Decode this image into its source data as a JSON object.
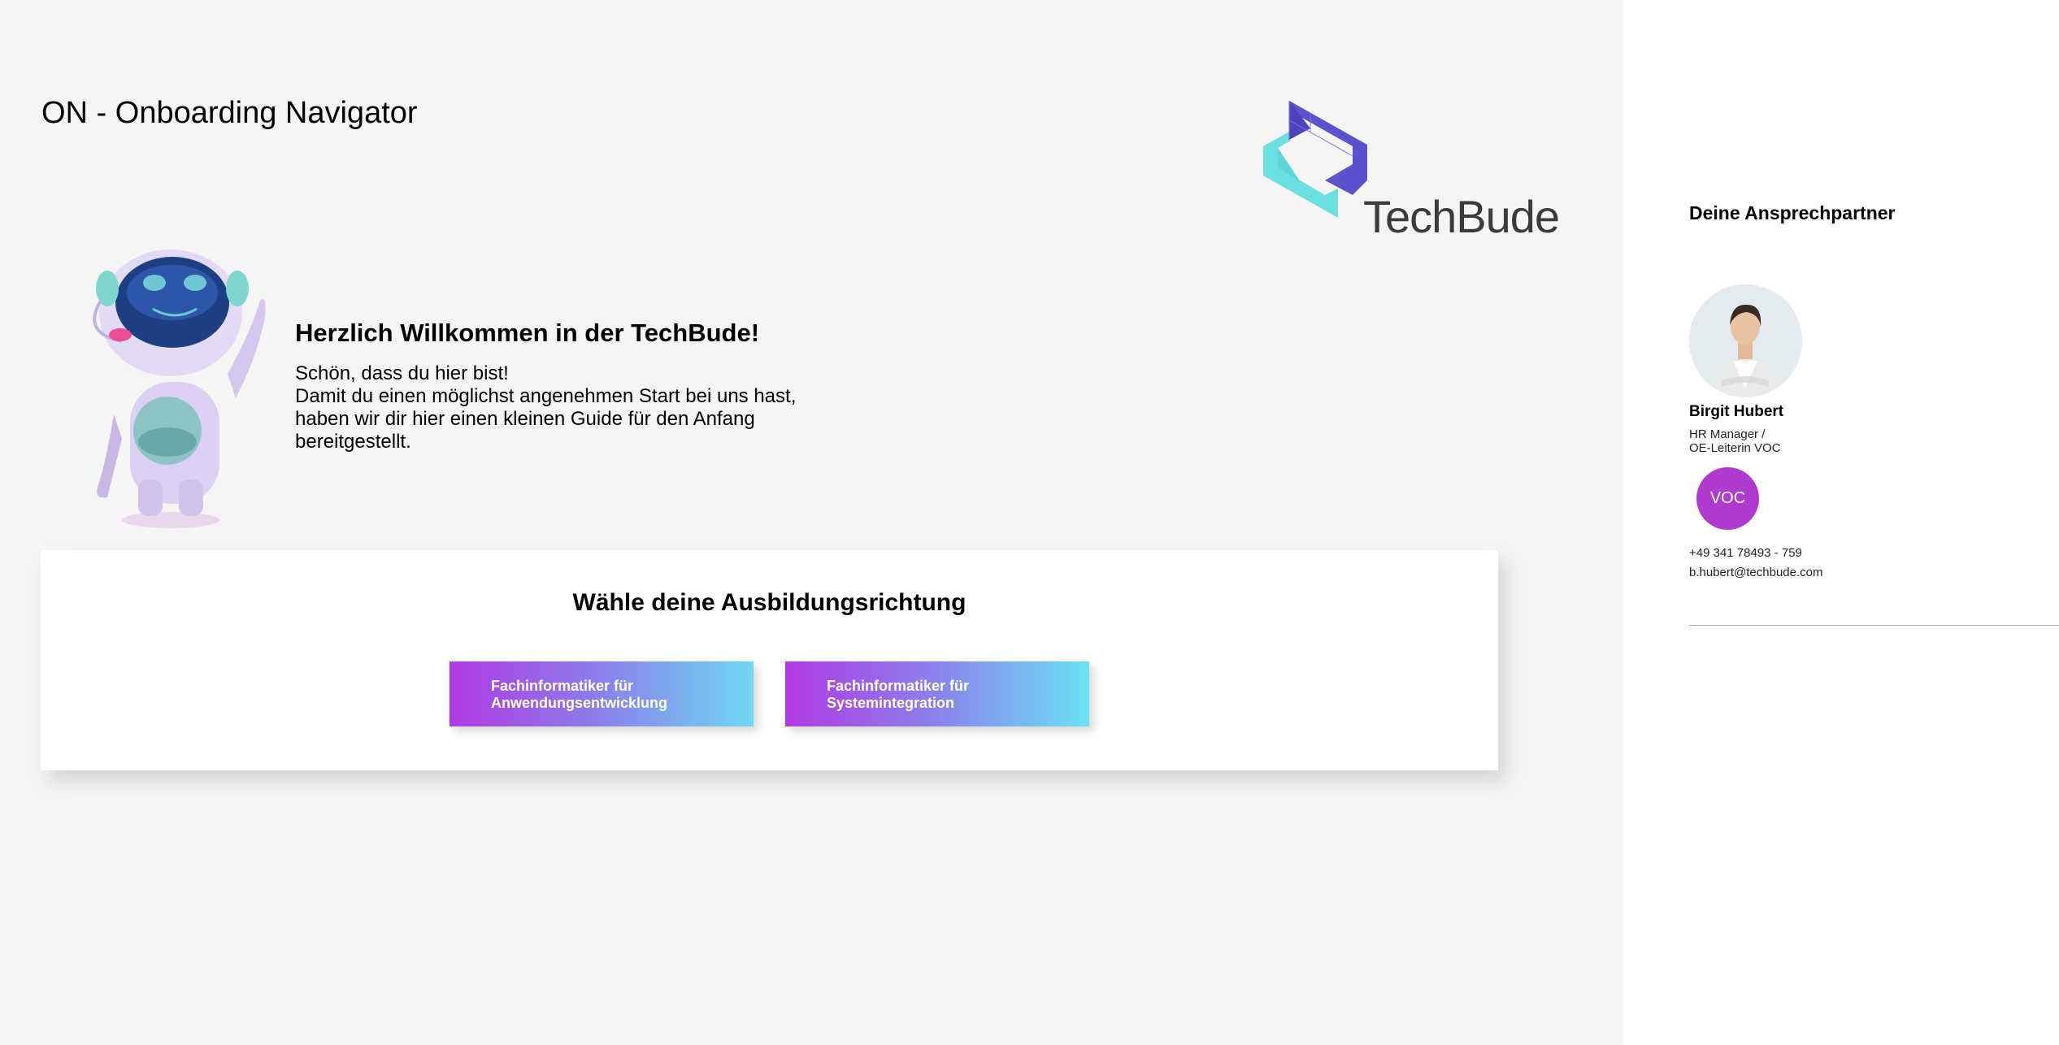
{
  "header": {
    "app_title": "ON - Onboarding Navigator",
    "logo_text": "TechBude"
  },
  "welcome": {
    "heading": "Herzlich Willkommen in der TechBude!",
    "lines": [
      "Schön, dass du hier bist!",
      "Damit du einen möglichst angenehmen Start bei uns hast,",
      "haben wir dir hier einen kleinen Guide für den Anfang",
      "bereitgestellt."
    ]
  },
  "selection": {
    "heading": "Wähle deine Ausbildungsrichtung",
    "options": [
      {
        "line1": "Fachinformatiker für",
        "line2": "Anwendungsentwicklung"
      },
      {
        "line1": "Fachinformatiker für",
        "line2": "Systemintegration"
      }
    ]
  },
  "sidebar": {
    "title": "Deine Ansprechpartner",
    "contact": {
      "name": "Birgit Hubert",
      "role_line1": "HR Manager /",
      "role_line2": "OE-Leiterin VOC",
      "badge": "VOC",
      "phone": "+49 341 78493 - 759",
      "email": "b.hubert@techbude.com"
    }
  },
  "colors": {
    "gradient_start": "#b23ae3",
    "gradient_end": "#6fd8f3",
    "badge": "#b03ad0",
    "logo_purple": "#5b52cf",
    "logo_cyan": "#6ae0e0"
  },
  "icons": {
    "mascot": "robot-mascot-icon",
    "logo": "techbude-logo-icon"
  }
}
